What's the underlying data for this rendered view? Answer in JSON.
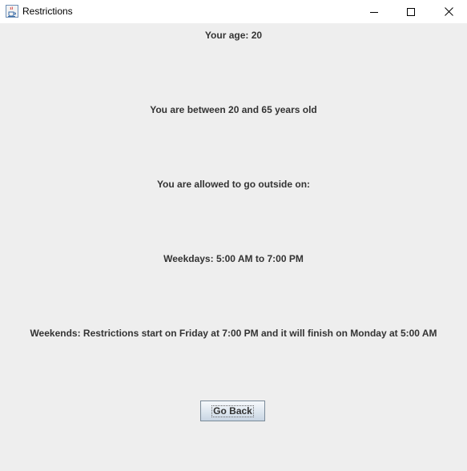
{
  "window": {
    "title": "Restrictions",
    "icon": "java-cup-icon"
  },
  "title_buttons": {
    "minimize_icon": "minimize-icon",
    "maximize_icon": "maximize-icon",
    "close_icon": "close-icon"
  },
  "content": {
    "age_line": "Your age: 20",
    "range_line": "You are between 20 and 65 years old",
    "allowed_line": "You are allowed to go outside on:",
    "weekdays_line": "Weekdays: 5:00 AM to 7:00 PM",
    "weekends_line": "Weekends: Restrictions start on Friday at 7:00 PM and it will finish on Monday at 5:00 AM"
  },
  "buttons": {
    "go_back_label": "Go Back"
  }
}
